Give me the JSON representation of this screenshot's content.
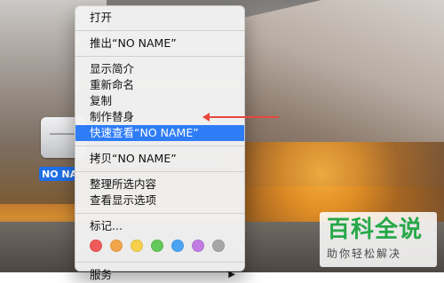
{
  "context_menu": {
    "open": "打开",
    "eject": "推出“NO NAME”",
    "get_info": "显示简介",
    "rename": "重新命名",
    "copy": "复制",
    "make_alias": "制作替身",
    "quick_look": "快速查看“NO NAME”",
    "copy_item": "拷贝“NO NAME”",
    "clean_up_selection": "整理所选内容",
    "show_view_options": "查看显示选项",
    "tags": "标记...",
    "services": "服务",
    "services_chevron": "▶"
  },
  "desktop": {
    "drive_label": "NO NAME"
  },
  "tag_colors": [
    {
      "name": "red-tag",
      "color": "#f05a5a"
    },
    {
      "name": "orange-tag",
      "color": "#f2a44a"
    },
    {
      "name": "yellow-tag",
      "color": "#f5d14c"
    },
    {
      "name": "green-tag",
      "color": "#64c85a"
    },
    {
      "name": "blue-tag",
      "color": "#4aa3f3"
    },
    {
      "name": "purple-tag",
      "color": "#c07ce3"
    },
    {
      "name": "gray-tag",
      "color": "#a7a7a7"
    }
  ],
  "watermark": {
    "top_text": "百科全说",
    "bottom_text": "助你轻松解决"
  },
  "colors": {
    "highlight": "#2f7df6",
    "arrow": "#e7473d",
    "watermark_green": "#26a848"
  }
}
